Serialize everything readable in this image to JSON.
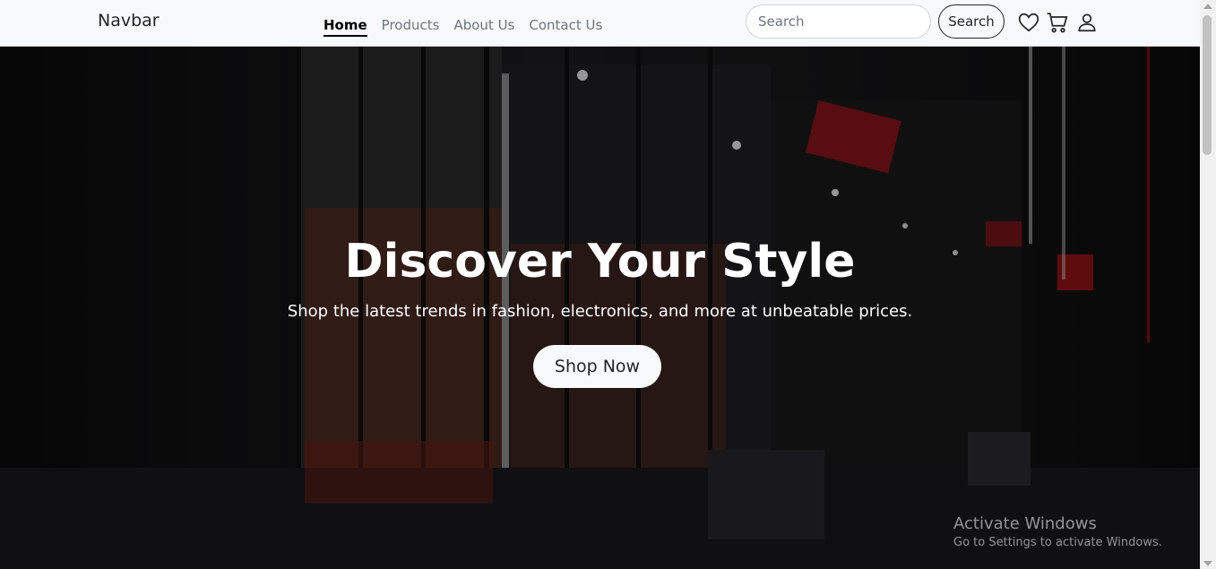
{
  "navbar": {
    "brand": "Navbar",
    "links": [
      {
        "label": "Home",
        "active": true
      },
      {
        "label": "Products",
        "active": false
      },
      {
        "label": "About Us",
        "active": false
      },
      {
        "label": "Contact Us",
        "active": false
      }
    ],
    "search": {
      "placeholder": "Search",
      "value": ""
    },
    "search_button": "Search",
    "icons": [
      "heart-icon",
      "cart-icon",
      "user-icon"
    ]
  },
  "hero": {
    "title": "Discover Your Style",
    "subtitle": "Shop the latest trends in fashion, electronics, and more at unbeatable prices.",
    "cta_label": "Shop Now"
  },
  "watermark": {
    "title": "Activate Windows",
    "subtitle": "Go to Settings to activate Windows."
  },
  "colors": {
    "navbar_bg": "#f8f9fa",
    "hero_text": "#ffffff",
    "active_link": "#000000",
    "muted_link": "#6c757d"
  }
}
